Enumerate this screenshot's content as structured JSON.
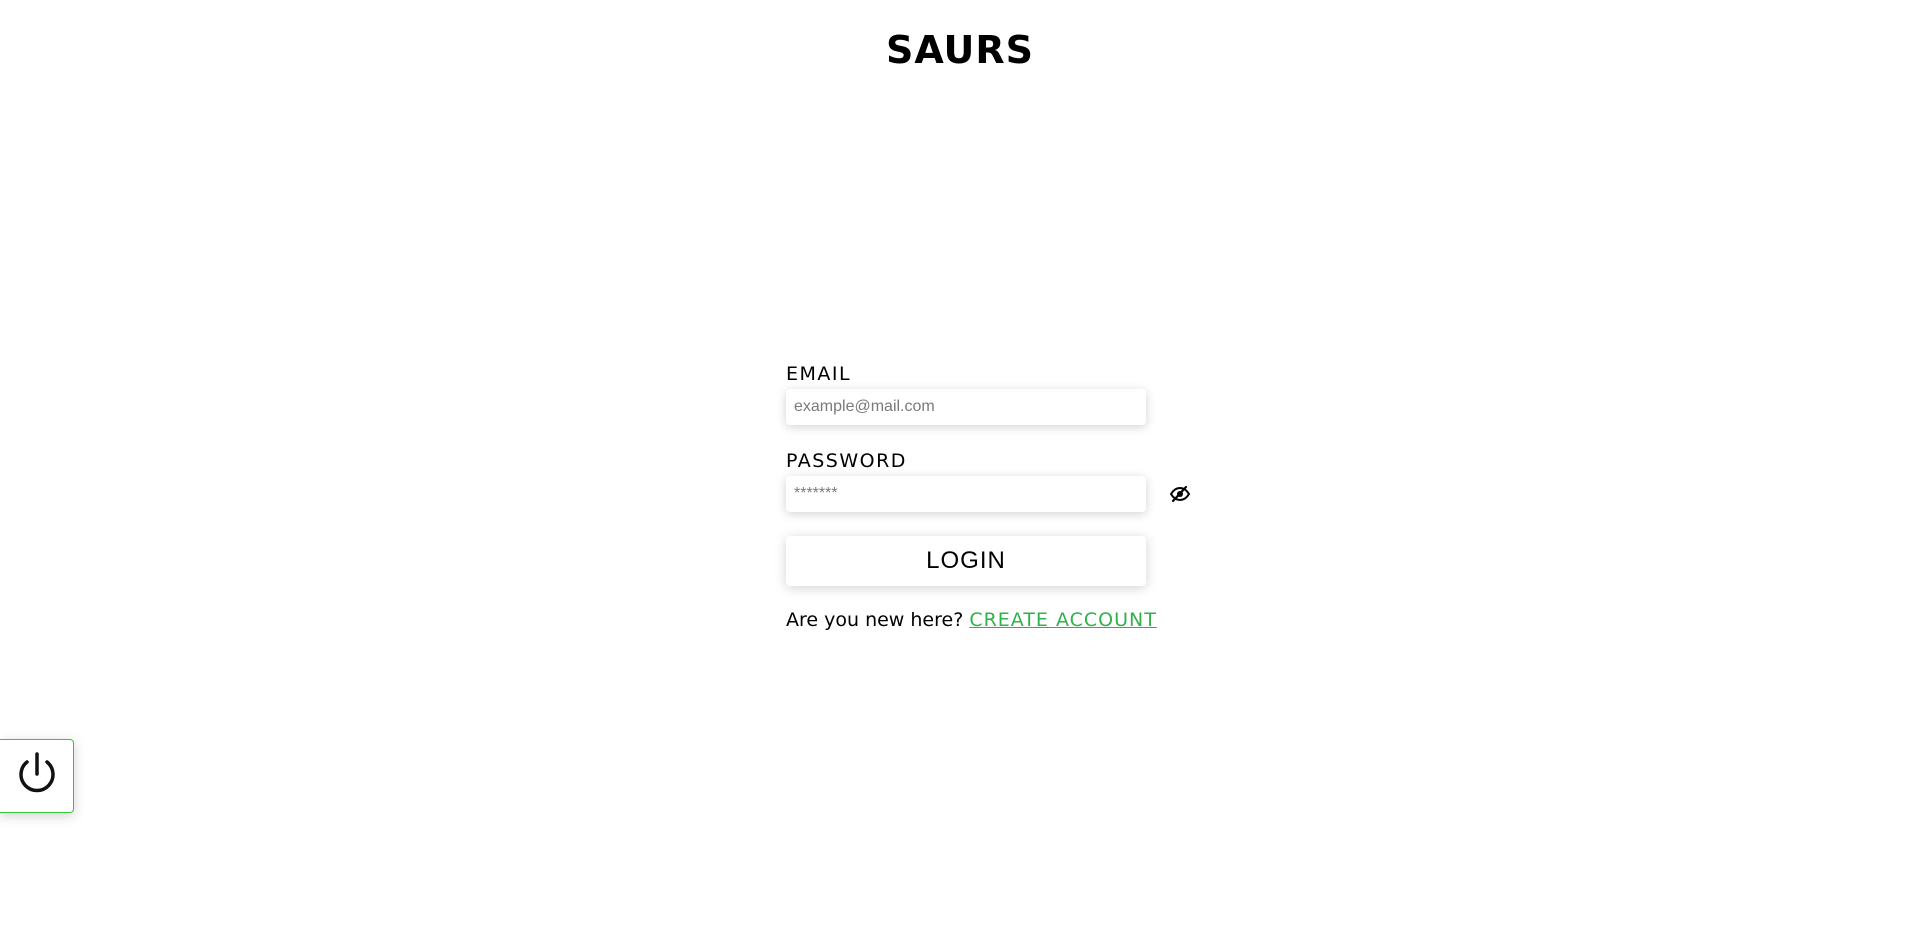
{
  "header": {
    "logo_text": "SAURS"
  },
  "form": {
    "email_label": "EMAIL",
    "email_placeholder": "example@mail.com",
    "email_value": "",
    "password_label": "PASSWORD",
    "password_placeholder": "*******",
    "password_value": "",
    "login_label": "LOGIN",
    "new_here_text": "Are you new here?",
    "create_account_label": "CREATE ACCOUNT"
  },
  "icons": {
    "password_toggle": "eye-slash-icon",
    "power": "power-icon"
  },
  "colors": {
    "accent_link": "#2fb24a",
    "power_border": "#35c83e"
  }
}
